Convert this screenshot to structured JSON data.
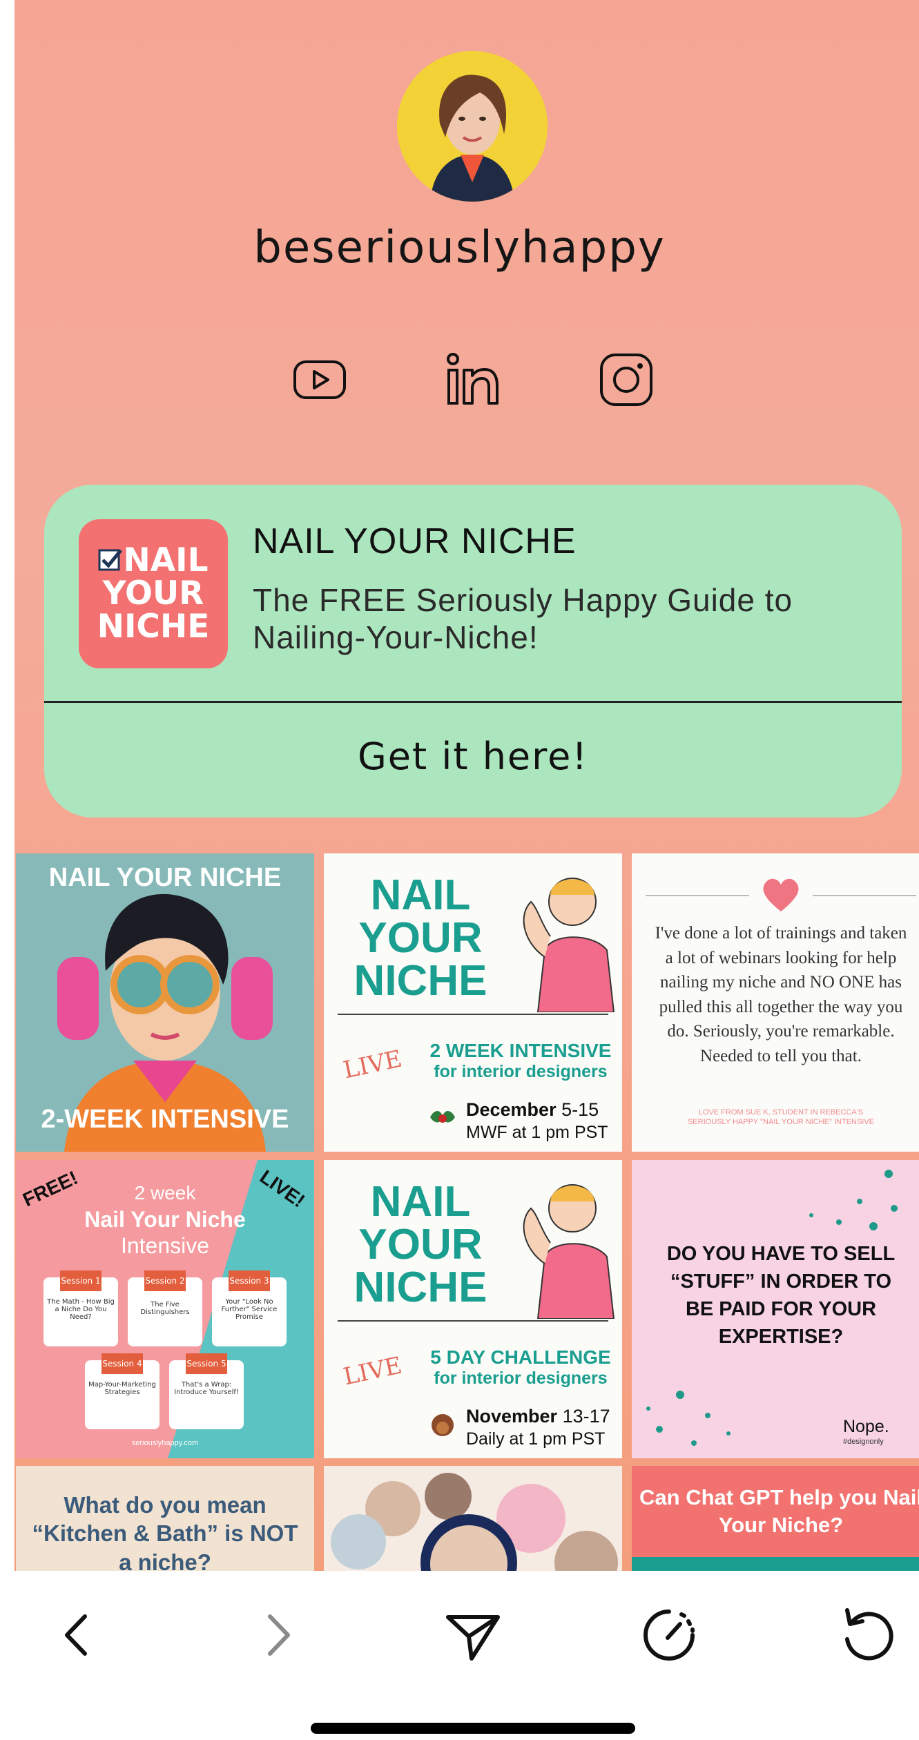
{
  "profile": {
    "username": "beseriouslyhappy",
    "avatar_icon": "profile-photo"
  },
  "social": {
    "icons": [
      "youtube-icon",
      "linkedin-icon",
      "instagram-icon"
    ]
  },
  "feature_card": {
    "logo_lines": [
      "NAIL",
      "YOUR",
      "NICHE"
    ],
    "title": "NAIL YOUR NICHE",
    "subtitle": "The FREE Seriously Happy Guide to Nailing-Your-Niche!",
    "cta": "Get it here!"
  },
  "grid": {
    "t1": {
      "title": "NAIL YOUR NICHE",
      "footer": "2-WEEK INTENSIVE"
    },
    "t2": {
      "title": [
        "NAIL",
        "YOUR",
        "NICHE"
      ],
      "live": "LIVE",
      "line1": "2 WEEK INTENSIVE",
      "line2": "for interior designers",
      "date": "December",
      "date_range": "5-15",
      "time": "MWF at 1 pm PST"
    },
    "t3": {
      "quote": "I've done a lot of trainings and taken a lot of webinars looking for help nailing my niche and NO ONE has pulled this all together the way you do. Seriously, you're remarkable. Needed to tell you that.",
      "credit": "LOVE FROM SUE K, STUDENT IN REBECCA'S SERIOUSLY HAPPY \"NAIL YOUR NICHE\" INTENSIVE"
    },
    "t4": {
      "free": "FREE!",
      "live": "LIVE!",
      "line1": "2 week",
      "line2": "Nail Your Niche",
      "line3": "Intensive",
      "sessions": [
        "Session 1",
        "Session 2",
        "Session 3",
        "Session 4",
        "Session 5"
      ],
      "session_text": [
        "The Math - How Big a Niche Do You Need?",
        "The Five Distinguishers",
        "Your \"Look No Further\" Service Promise",
        "Map-Your-Marketing Strategies",
        "That's a Wrap: Introduce Yourself!"
      ],
      "url": "seriouslyhappy.com"
    },
    "t5": {
      "title": [
        "NAIL",
        "YOUR",
        "NICHE"
      ],
      "live": "LIVE",
      "line1": "5 DAY CHALLENGE",
      "line2": "for interior designers",
      "date": "November",
      "date_range": "13-17",
      "time": "Daily at 1 pm PST"
    },
    "t6": {
      "text": "DO YOU HAVE TO SELL “STUFF” IN ORDER TO BE PAID FOR YOUR EXPERTISE?",
      "answer": "Nope.",
      "tag": "#designonly"
    },
    "t7": {
      "text": "What do you mean “Kitchen & Bath” is NOT a niche?"
    },
    "t9": {
      "text": "Can Chat GPT help you Nail Your Niche?"
    }
  },
  "toolbar": {
    "icons": [
      "back-icon",
      "forward-icon",
      "share-icon",
      "speed-icon",
      "reload-icon"
    ]
  },
  "colors": {
    "card_bg": "#ace6bf",
    "logo_bg": "#f37171",
    "teal": "#1a9e8f",
    "pink": "#f26b8a"
  }
}
